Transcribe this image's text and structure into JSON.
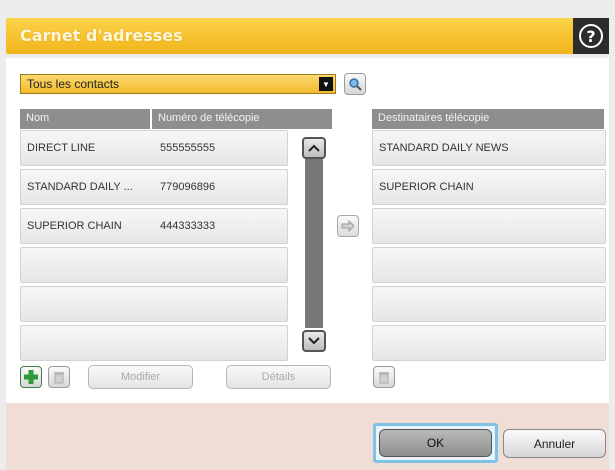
{
  "window": {
    "title": "Carnet d'adresses",
    "help_glyph": "?"
  },
  "filter": {
    "selected": "Tous les contacts"
  },
  "contacts": {
    "columns": {
      "name": "Nom",
      "fax": "Numéro de télécopie"
    },
    "rows": [
      {
        "name": "DIRECT LINE",
        "fax": "555555555"
      },
      {
        "name": "STANDARD DAILY ...",
        "fax": "779096896"
      },
      {
        "name": "SUPERIOR CHAIN",
        "fax": "444333333"
      },
      {
        "name": "",
        "fax": ""
      },
      {
        "name": "",
        "fax": ""
      },
      {
        "name": "",
        "fax": ""
      }
    ]
  },
  "recipients": {
    "header": "Destinataires télécopie",
    "rows": [
      "STANDARD DAILY NEWS",
      "SUPERIOR CHAIN",
      "",
      "",
      "",
      ""
    ]
  },
  "buttons": {
    "modify": "Modifier",
    "details": "Détails",
    "ok": "OK",
    "cancel": "Annuler"
  },
  "icons": {
    "search": "magnifier-icon",
    "scroll_up": "chevron-up-icon",
    "scroll_down": "chevron-down-icon",
    "move": "arrow-right-icon",
    "add": "plus-icon",
    "delete": "trash-icon"
  },
  "colors": {
    "title_bar": "#f1b41a",
    "accent_add": "#2f9a3a",
    "focus": "#7ec2e6"
  }
}
